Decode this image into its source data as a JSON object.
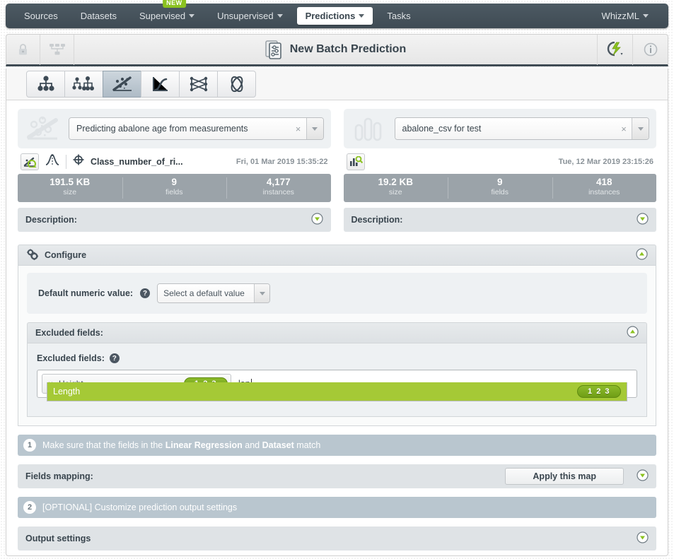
{
  "nav": {
    "items": [
      {
        "label": "Sources",
        "caret": false,
        "active": false,
        "badge": null
      },
      {
        "label": "Datasets",
        "caret": false,
        "active": false,
        "badge": null
      },
      {
        "label": "Supervised",
        "caret": true,
        "active": false,
        "badge": "NEW"
      },
      {
        "label": "Unsupervised",
        "caret": true,
        "active": false,
        "badge": null
      },
      {
        "label": "Predictions",
        "caret": true,
        "active": true,
        "badge": null
      },
      {
        "label": "Tasks",
        "caret": false,
        "active": false,
        "badge": null
      }
    ],
    "right": {
      "label": "WhizzML",
      "caret": true
    }
  },
  "header": {
    "title": "New Batch Prediction",
    "lock_icon": "lock-icon",
    "share_icon": "share-network-icon",
    "actions_icon": "lightning-actions-icon",
    "info_icon": "info-icon"
  },
  "type_tabs": [
    {
      "name": "model-icon",
      "selected": false
    },
    {
      "name": "ensemble-icon",
      "selected": false
    },
    {
      "name": "linear-regression-icon",
      "selected": true
    },
    {
      "name": "logistic-regression-icon",
      "selected": false
    },
    {
      "name": "deepnet-icon",
      "selected": false
    },
    {
      "name": "fusion-icon",
      "selected": false
    }
  ],
  "model_card": {
    "resource_icon": "linear-regression-icon",
    "selected": "Predicting abalone age from measurements",
    "clear_label": "×",
    "meta_icon": "linear-regression-search-icon",
    "distribution_icon": "distribution-icon",
    "objective_icon": "objective-field-icon",
    "objective_field": "Class_number_of_ri...",
    "date": "Fri, 01 Mar 2019 15:35:22",
    "stats": [
      {
        "value": "191.5 KB",
        "key": "size"
      },
      {
        "value": "9",
        "key": "fields"
      },
      {
        "value": "4,177",
        "key": "instances"
      }
    ],
    "description_label": "Description:"
  },
  "dataset_card": {
    "resource_icon": "dataset-icon",
    "selected": "abalone_csv for test",
    "clear_label": "×",
    "meta_icon": "dataset-search-icon",
    "date": "Tue, 12 Mar 2019 23:15:26",
    "stats": [
      {
        "value": "19.2 KB",
        "key": "size"
      },
      {
        "value": "9",
        "key": "fields"
      },
      {
        "value": "418",
        "key": "instances"
      }
    ],
    "description_label": "Description:"
  },
  "configure": {
    "title": "Configure",
    "icon": "gears-icon",
    "default_numeric": {
      "label": "Default numeric value:",
      "help": "?",
      "value": "Select a default value"
    },
    "excluded_panel_title": "Excluded fields:",
    "excluded_fields": {
      "label": "Excluded fields:",
      "help": "?",
      "tokens": [
        {
          "label": "Height",
          "badge": "1 2 3",
          "remove": "×"
        }
      ],
      "typed_text": "len",
      "suggestions": [
        {
          "label": "Length",
          "badge": "1 2 3",
          "highlighted": true
        }
      ]
    }
  },
  "step1": {
    "number": "1",
    "text_before": "Make sure that the fields in the ",
    "bold1": "Linear Regression",
    "text_mid": " and ",
    "bold2": "Dataset",
    "text_after": " match"
  },
  "fields_mapping": {
    "label": "Fields mapping:",
    "apply_button": "Apply this map"
  },
  "step2": {
    "number": "2",
    "text": "[OPTIONAL] Customize prediction output settings"
  },
  "output_settings": {
    "label": "Output settings"
  },
  "colors": {
    "nav_bg": "#434f58",
    "accent_green": "#8bc220",
    "badge_green": "#7aa81d",
    "suggest_green": "#a5c936",
    "step_bar": "#b9c6cf",
    "stats_bg": "#9ba3a9"
  }
}
